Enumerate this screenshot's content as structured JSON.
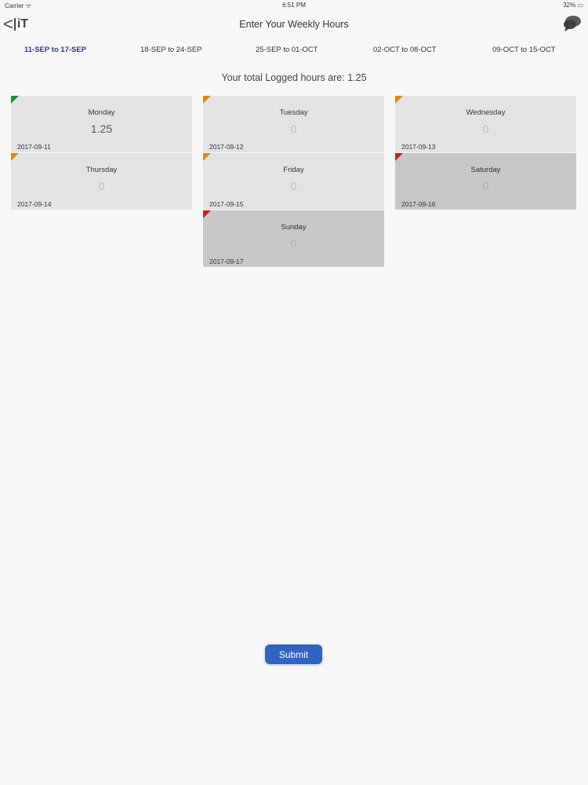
{
  "status_bar": {
    "carrier": "Carrier ᯤ",
    "time": "6:51 PM",
    "battery": "32% ▭"
  },
  "header": {
    "title": "Enter Your Weekly Hours",
    "back_icon": "back-chevron-icon",
    "logo_text": "iT",
    "chat_icon": "chat-bubbles-icon"
  },
  "weeks": [
    {
      "label": "11-SEP to 17-SEP",
      "active": true
    },
    {
      "label": "18-SEP to 24-SEP",
      "active": false
    },
    {
      "label": "25-SEP to 01-OCT",
      "active": false
    },
    {
      "label": "02-OCT to 08-OCT",
      "active": false
    },
    {
      "label": "09-OCT to 15-OCT",
      "active": false
    }
  ],
  "total_text": "Your total Logged hours are: 1.25",
  "days": [
    {
      "day": "Monday",
      "hours": "1.25",
      "date": "2017-09-11",
      "status_color": "#1f8f2f"
    },
    {
      "day": "Tuesday",
      "hours": "0",
      "date": "2017-09-12",
      "status_color": "#e08a00"
    },
    {
      "day": "Wednesday",
      "hours": "0",
      "date": "2017-09-13",
      "status_color": "#e08a00"
    },
    {
      "day": "Thursday",
      "hours": "0",
      "date": "2017-09-14",
      "status_color": "#e08a00"
    },
    {
      "day": "Friday",
      "hours": "0",
      "date": "2017-09-15",
      "status_color": "#e08a00"
    },
    {
      "day": "Saturday",
      "hours": "0",
      "date": "2017-09-16",
      "status_color": "#e01818"
    },
    {
      "day": "Sunday",
      "hours": "0",
      "date": "2017-09-17",
      "status_color": "#e01818"
    }
  ],
  "submit_label": "Submit",
  "colors": {
    "accent": "#2f63c4",
    "active_tab": "#2a3d8f"
  }
}
